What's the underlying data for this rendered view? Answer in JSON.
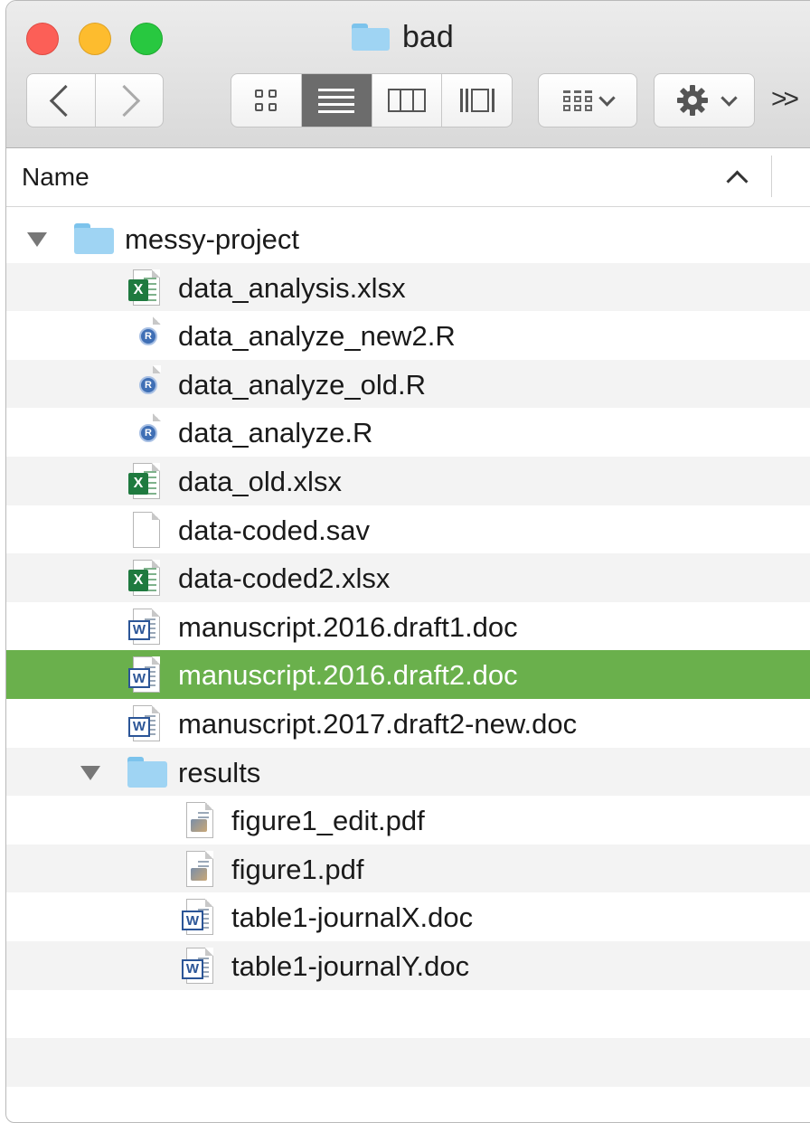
{
  "window": {
    "title": "bad"
  },
  "header": {
    "name_column": "Name"
  },
  "rows": [
    {
      "label": "messy-project",
      "kind": "folder",
      "level": 0,
      "expanded": true
    },
    {
      "label": "data_analysis.xlsx",
      "kind": "xlsx",
      "level": 1
    },
    {
      "label": "data_analyze_new2.R",
      "kind": "r",
      "level": 1
    },
    {
      "label": "data_analyze_old.R",
      "kind": "r",
      "level": 1
    },
    {
      "label": "data_analyze.R",
      "kind": "r",
      "level": 1
    },
    {
      "label": "data_old.xlsx",
      "kind": "xlsx",
      "level": 1
    },
    {
      "label": "data-coded.sav",
      "kind": "blank",
      "level": 1
    },
    {
      "label": "data-coded2.xlsx",
      "kind": "xlsx",
      "level": 1
    },
    {
      "label": "manuscript.2016.draft1.doc",
      "kind": "doc",
      "level": 1
    },
    {
      "label": "manuscript.2016.draft2.doc",
      "kind": "doc",
      "level": 1,
      "selected": true
    },
    {
      "label": "manuscript.2017.draft2-new.doc",
      "kind": "doc",
      "level": 1
    },
    {
      "label": "results",
      "kind": "folder",
      "level": 1,
      "expanded": true
    },
    {
      "label": "figure1_edit.pdf",
      "kind": "pdf",
      "level": 2
    },
    {
      "label": "figure1.pdf",
      "kind": "pdf",
      "level": 2
    },
    {
      "label": "table1-journalX.doc",
      "kind": "doc",
      "level": 2
    },
    {
      "label": "table1-journalY.doc",
      "kind": "doc",
      "level": 2
    },
    {
      "label": "",
      "kind": "empty",
      "level": 0
    },
    {
      "label": "",
      "kind": "empty",
      "level": 0
    },
    {
      "label": "",
      "kind": "empty",
      "level": 0
    }
  ],
  "icons": {
    "back": "chevron-left-icon",
    "forward": "chevron-right-icon",
    "views": [
      "icon-view-icon",
      "list-view-icon",
      "column-view-icon",
      "cover-flow-icon"
    ],
    "arrange": "arrange-grid-icon",
    "action": "gear-icon",
    "overflow": "double-chevron-right-icon",
    "sort": "sort-ascending-icon"
  },
  "colors": {
    "selection": "#6ab04c",
    "folder": "#9fd4f3",
    "close": "#fc5f57",
    "minimize": "#fdbc2e",
    "zoom": "#28c840"
  }
}
